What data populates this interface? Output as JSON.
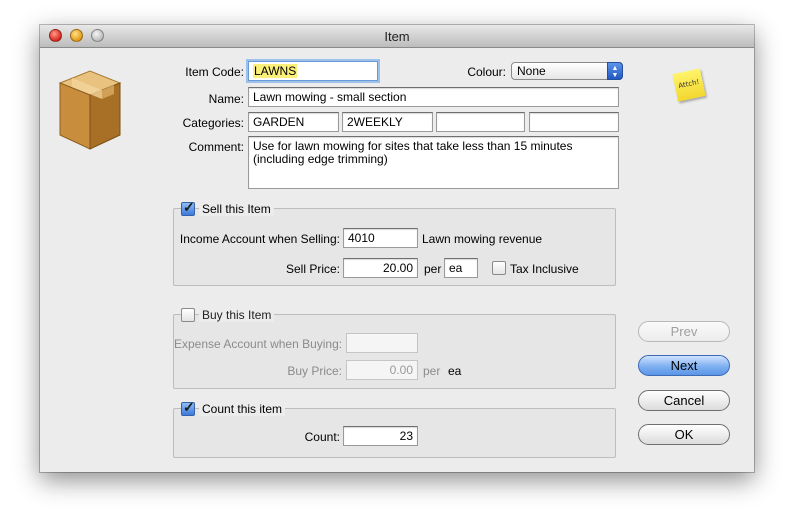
{
  "window": {
    "title": "Item"
  },
  "attach_note": {
    "icon": "sticky-note-icon",
    "text": "Attch!"
  },
  "form": {
    "item_code": {
      "label": "Item Code:",
      "value": "LAWNS"
    },
    "colour": {
      "label": "Colour:",
      "value": "None"
    },
    "name": {
      "label": "Name:",
      "value": "Lawn mowing - small section"
    },
    "categories": {
      "label": "Categories:",
      "values": [
        "GARDEN",
        "2WEEKLY",
        "",
        ""
      ]
    },
    "comment": {
      "label": "Comment:",
      "value": "Use for lawn mowing for sites that take less than 15 minutes (including edge trimming)"
    }
  },
  "sell": {
    "title": "Sell this Item",
    "checked": true,
    "income_label": "Income Account when Selling:",
    "income_account": "4010",
    "income_account_name": "Lawn mowing revenue",
    "price_label": "Sell Price:",
    "price": "20.00",
    "per_label": "per",
    "unit": "ea",
    "tax_inclusive_label": "Tax Inclusive",
    "tax_inclusive": false
  },
  "buy": {
    "title": "Buy this Item",
    "checked": false,
    "expense_label": "Expense Account when Buying:",
    "expense_account": "",
    "price_label": "Buy Price:",
    "price": "0.00",
    "per_label": "per",
    "unit": "ea"
  },
  "count": {
    "title": "Count this item",
    "checked": true,
    "label": "Count:",
    "value": "23"
  },
  "buttons": {
    "prev": "Prev",
    "next": "Next",
    "cancel": "Cancel",
    "ok": "OK"
  }
}
